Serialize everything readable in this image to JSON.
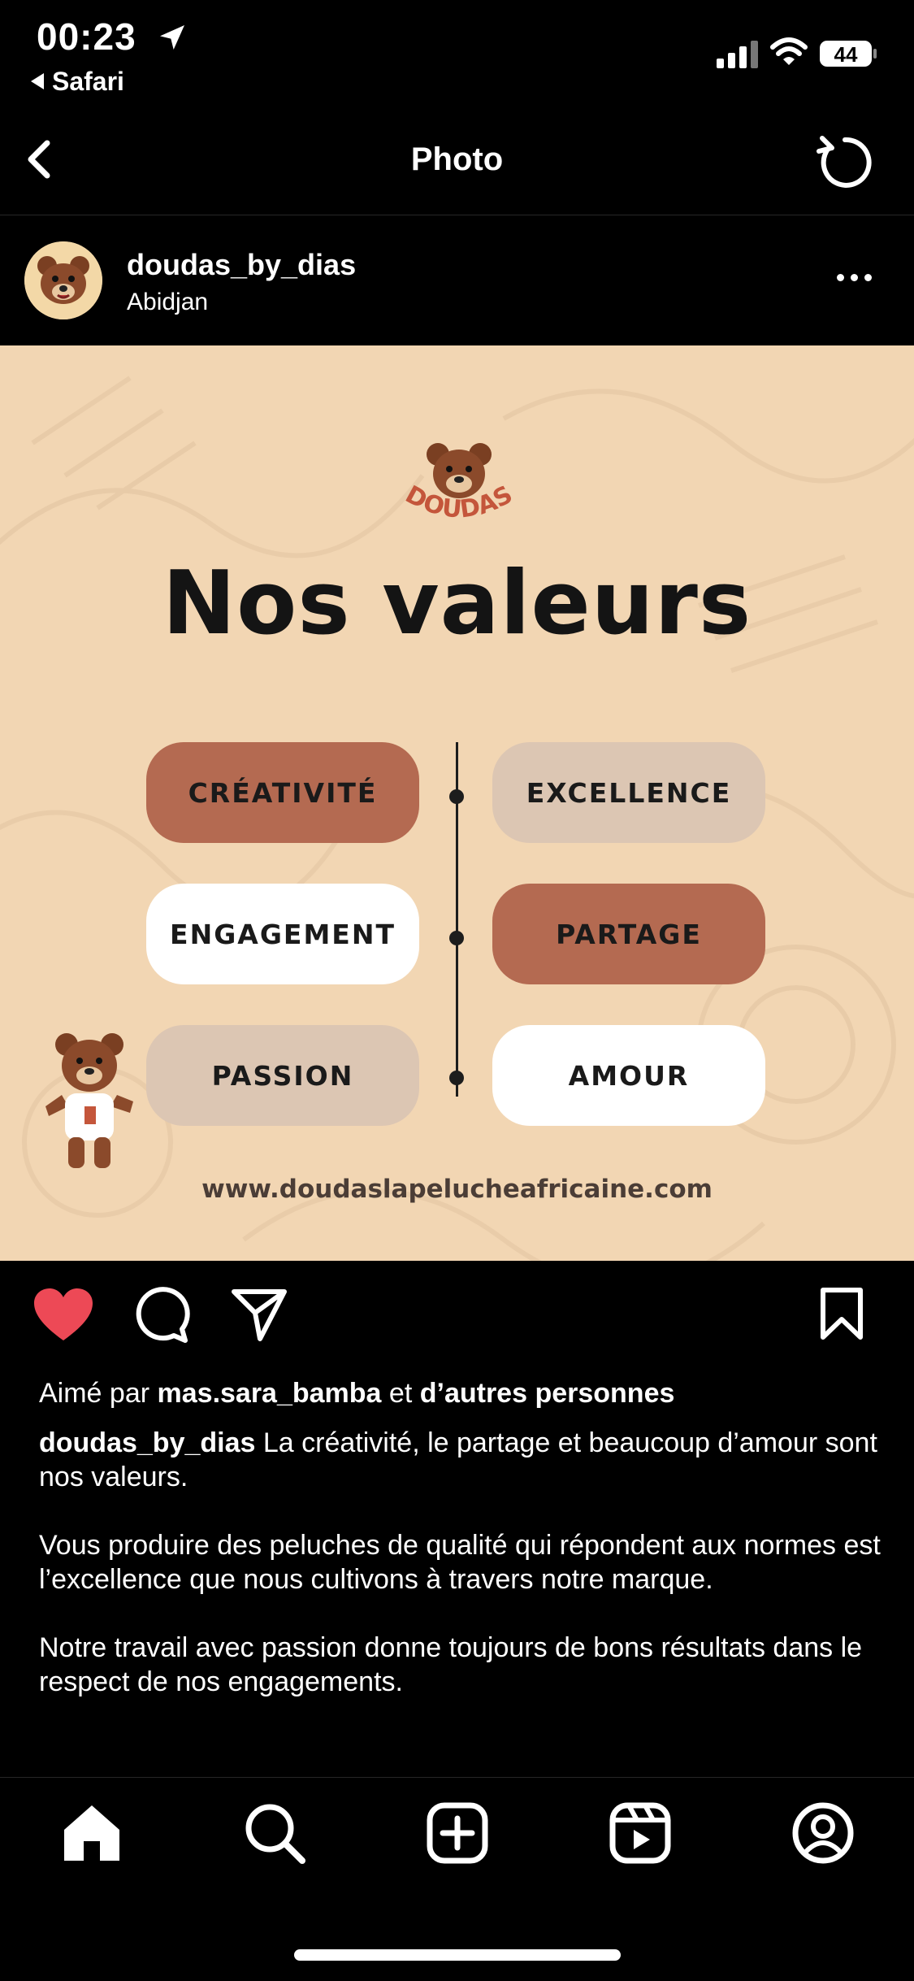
{
  "status_bar": {
    "time": "00:23",
    "back_app": "Safari",
    "battery": "44"
  },
  "nav": {
    "title": "Photo"
  },
  "post": {
    "username": "doudas_by_dias",
    "location": "Abidjan",
    "image": {
      "brand": "DOUDAS",
      "title": "Nos valeurs",
      "values": [
        {
          "label": "CRÉATIVITÉ",
          "style": "brown"
        },
        {
          "label": "EXCELLENCE",
          "style": "beige"
        },
        {
          "label": "ENGAGEMENT",
          "style": "white"
        },
        {
          "label": "PARTAGE",
          "style": "brown"
        },
        {
          "label": "PASSION",
          "style": "beige"
        },
        {
          "label": "AMOUR",
          "style": "white"
        }
      ],
      "website": "www.doudaslapelucheafricaine.com"
    },
    "likes": {
      "prefix": "Aimé par",
      "user": "mas.sara_bamba",
      "joiner": "et",
      "others": "d’autres personnes"
    },
    "caption": {
      "author": "doudas_by_dias",
      "p1": "La créativité, le partage et beaucoup d’amour sont nos valeurs.",
      "p2": "Vous produire des peluches de qualité qui répondent aux normes est l’excellence que nous cultivons à travers notre marque.",
      "p3": "Notre travail avec passion donne toujours de bons résultats dans le respect de nos engagements."
    }
  },
  "colors": {
    "like_red": "#ed4956",
    "pill_brown": "#b46a51",
    "pill_beige": "#dcc6b3",
    "image_bg": "#f2d6b3"
  },
  "icons": [
    "location-arrow-icon",
    "signal-icon",
    "wifi-icon",
    "battery-icon",
    "back-chevron-icon",
    "refresh-icon",
    "more-icon",
    "heart-icon",
    "comment-icon",
    "share-icon",
    "bookmark-icon",
    "home-icon",
    "search-icon",
    "create-icon",
    "reels-icon",
    "profile-icon"
  ]
}
